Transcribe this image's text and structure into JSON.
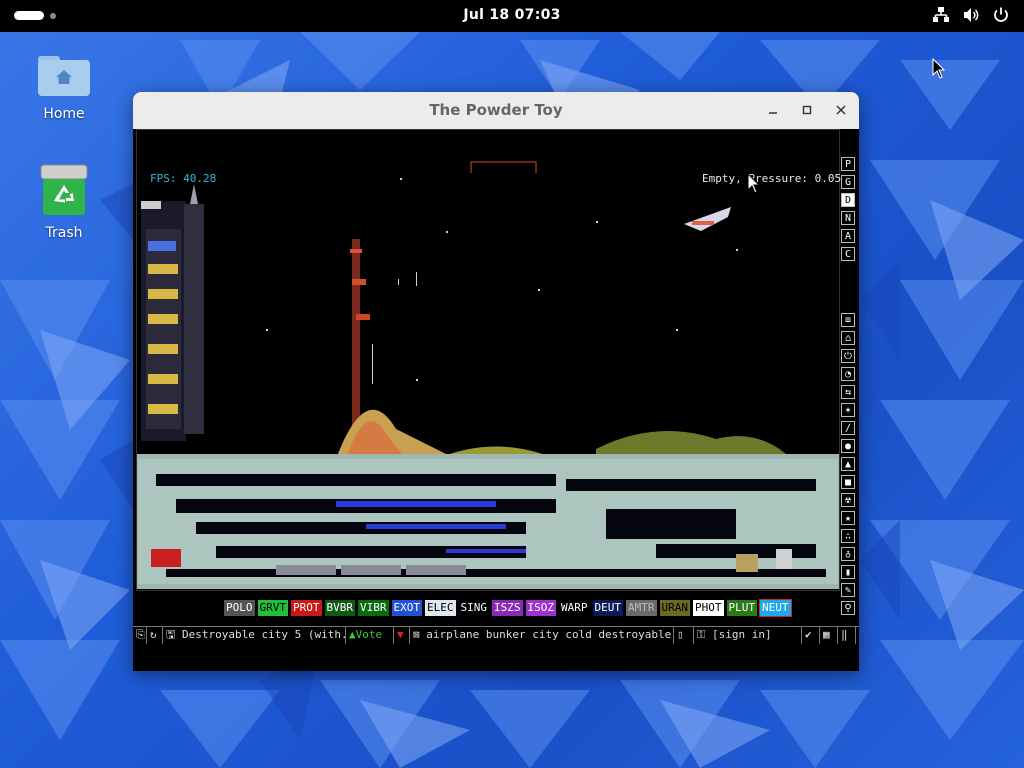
{
  "topbar": {
    "clock": "Jul 18  07:03",
    "icons": [
      "network-icon",
      "volume-icon",
      "power-icon"
    ]
  },
  "desktop": {
    "icons": [
      {
        "label": "Home",
        "icon": "folder-home-icon"
      },
      {
        "label": "Trash",
        "icon": "trash-icon"
      }
    ]
  },
  "window": {
    "title": "The Powder Toy",
    "controls": [
      "minimize",
      "maximize",
      "close"
    ]
  },
  "game": {
    "fps": "FPS: 40.28",
    "pressure": "Empty, Pressure: 0.05",
    "display_modes": [
      {
        "label": "P",
        "active": false
      },
      {
        "label": "G",
        "active": false
      },
      {
        "label": "D",
        "active": true
      },
      {
        "label": "N",
        "active": false
      },
      {
        "label": "A",
        "active": false
      },
      {
        "label": "C",
        "active": false
      }
    ],
    "tool_categories": [
      "walls-icon",
      "electronics-icon",
      "powered-icon",
      "sensors-icon",
      "force-icon",
      "explosives-icon",
      "gases-icon",
      "liquids-icon",
      "powders-icon",
      "solids-icon",
      "radioactive-icon",
      "special-icon",
      "life-icon",
      "tools-icon",
      "favorites-icon",
      "decoration-icon",
      "search-icon"
    ],
    "elements": [
      {
        "label": "POLO",
        "bg": "#555555",
        "fg": "#ffffff"
      },
      {
        "label": "GRVT",
        "bg": "#22c03a",
        "fg": "#000000"
      },
      {
        "label": "PROT",
        "bg": "#c81818",
        "fg": "#ffffff"
      },
      {
        "label": "BVBR",
        "bg": "#0f5a12",
        "fg": "#ffffff"
      },
      {
        "label": "VIBR",
        "bg": "#0a6a10",
        "fg": "#ffffff"
      },
      {
        "label": "EXOT",
        "bg": "#2450d6",
        "fg": "#ffffff"
      },
      {
        "label": "ELEC",
        "bg": "#dfe6f0",
        "fg": "#000000"
      },
      {
        "label": "SING",
        "bg": "#000000",
        "fg": "#ffffff"
      },
      {
        "label": "ISZS",
        "bg": "#8a2ab8",
        "fg": "#ffffff"
      },
      {
        "label": "ISOZ",
        "bg": "#a030d0",
        "fg": "#ffffff"
      },
      {
        "label": "WARP",
        "bg": "#000000",
        "fg": "#ffffff"
      },
      {
        "label": "DEUT",
        "bg": "#0d1a5a",
        "fg": "#ffffff"
      },
      {
        "label": "AMTR",
        "bg": "#6a6a6a",
        "fg": "#bbbbbb"
      },
      {
        "label": "URAN",
        "bg": "#6b6b1f",
        "fg": "#000000"
      },
      {
        "label": "PHOT",
        "bg": "#ffffff",
        "fg": "#000000"
      },
      {
        "label": "PLUT",
        "bg": "#2a7a1a",
        "fg": "#ffffff"
      },
      {
        "label": "NEUT",
        "bg": "#20a8ee",
        "fg": "#ffffff",
        "selected": true
      }
    ],
    "bottom": {
      "save_name": "Destroyable city 5 (with...",
      "vote_label": "Vote",
      "tags": "airplane bunker city cold destroyable qu...",
      "sign_in": "[sign in]"
    }
  }
}
